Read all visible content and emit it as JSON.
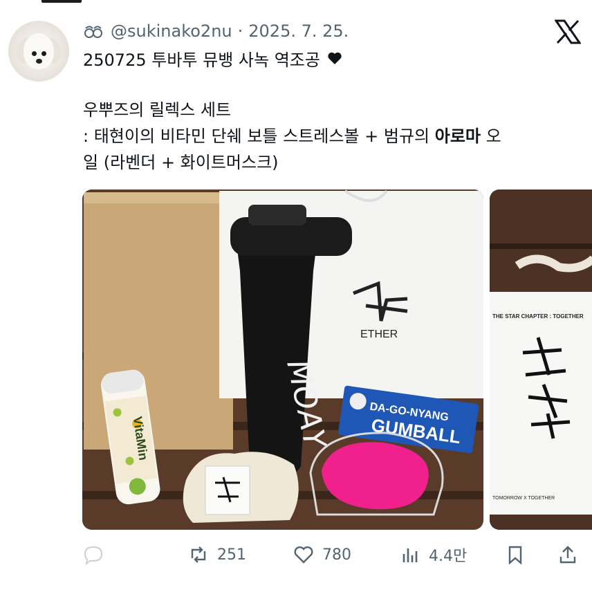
{
  "post": {
    "handle": "@sukinako2nu",
    "separator": "·",
    "date": "2025. 7. 25.",
    "headline": "250725 투바투 뮤뱅 사녹 역조공",
    "body": {
      "line1": "우뿌즈의 릴렉스 세트",
      "line2": ": 태현이의 비타민 단쉐 보틀 스트레스볼 + 범규의 ",
      "line2_bold": "아로마",
      "line2_end": " 오",
      "line3": "일 (라벤더 + 화이트머스크)"
    }
  },
  "photo1": {
    "bottle_text": "MOAY",
    "bag_text": "ETHER",
    "vitamin_text": "VitaMin",
    "gumball_line1": "DA-GO-NYANG",
    "gumball_line2": "GUMBALL"
  },
  "photo2": {
    "card_title": "THE STAR CHAPTER : TOGETHER",
    "card_footer": "TOMORROW X TOGETHER"
  },
  "actions": {
    "reply_count": "",
    "repost_count": "251",
    "like_count": "780",
    "view_count": "4.4만"
  },
  "icons": [
    "repost-indicator-icon",
    "x-logo-icon",
    "heart-icon",
    "reply-icon",
    "repost-icon",
    "like-icon",
    "views-icon",
    "bookmark-icon",
    "share-icon"
  ],
  "colors": {
    "text": "#0f1419",
    "muted": "#536471",
    "background": "#ffffff"
  }
}
